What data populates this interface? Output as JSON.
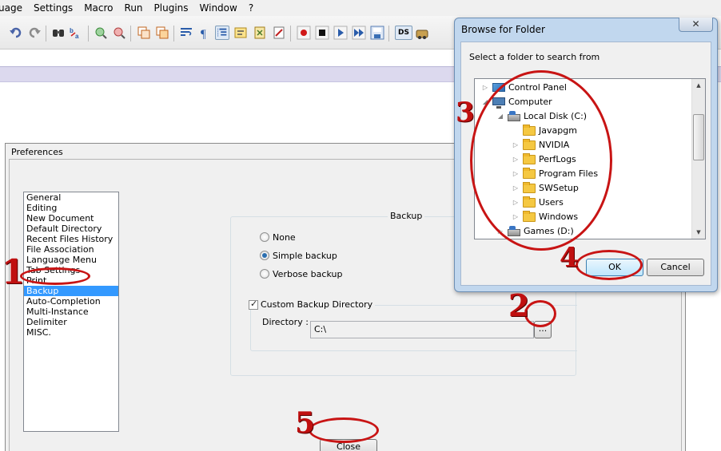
{
  "menubar": {
    "items": [
      "uage",
      "Settings",
      "Macro",
      "Run",
      "Plugins",
      "Window",
      "?"
    ]
  },
  "toolbar": {
    "buttons": [
      "undo-icon",
      "redo-icon",
      "find-icon",
      "replace-icon",
      "zoom-in-icon",
      "zoom-out-icon",
      "sync-vertical-icon",
      "sync-horizontal-icon",
      "word-wrap-icon",
      "show-all-characters-icon",
      "indent-guide-icon",
      "user-language-icon",
      "document-map-icon",
      "function-list-icon",
      "record-macro-icon",
      "stop-recording-icon",
      "play-macro-icon",
      "run-macro-multiple-icon",
      "save-macro-icon",
      "ds-icon",
      "plugin-icon"
    ],
    "ds_label": "DS"
  },
  "preferences": {
    "title": "Preferences",
    "categories": [
      "General",
      "Editing",
      "New Document",
      "Default Directory",
      "Recent Files History",
      "File Association",
      "Language Menu",
      "Tab Settings",
      "Print",
      "Backup",
      "Auto-Completion",
      "Multi-Instance",
      "Delimiter",
      "MISC."
    ],
    "selected_category": "Backup",
    "backup": {
      "legend": "Backup",
      "options": [
        "None",
        "Simple backup",
        "Verbose backup"
      ],
      "selected": "Simple backup"
    },
    "custom_dir": {
      "label": "Custom Backup Directory",
      "checked": true,
      "directory_label": "Directory :",
      "directory_value": "C:\\",
      "browse_label": "..."
    },
    "close_label": "Close"
  },
  "browse_dialog": {
    "title": "Browse for Folder",
    "close_glyph": "✕",
    "instruction": "Select a folder to search from",
    "tree": [
      {
        "label": "Control Panel",
        "icon": "control-panel-icon",
        "level": 0,
        "arrow": "▷"
      },
      {
        "label": "Computer",
        "icon": "computer-icon",
        "level": 0,
        "arrow": "◢"
      },
      {
        "label": "Local Disk (C:)",
        "icon": "local-disk-icon",
        "level": 1,
        "arrow": "◢"
      },
      {
        "label": "Javapgm",
        "icon": "folder-icon",
        "level": 2,
        "arrow": ""
      },
      {
        "label": "NVIDIA",
        "icon": "folder-icon",
        "level": 2,
        "arrow": "▷"
      },
      {
        "label": "PerfLogs",
        "icon": "folder-icon",
        "level": 2,
        "arrow": "▷"
      },
      {
        "label": "Program Files",
        "icon": "folder-icon",
        "level": 2,
        "arrow": "▷"
      },
      {
        "label": "SWSetup",
        "icon": "folder-icon",
        "level": 2,
        "arrow": "▷"
      },
      {
        "label": "Users",
        "icon": "folder-icon",
        "level": 2,
        "arrow": "▷"
      },
      {
        "label": "Windows",
        "icon": "folder-icon",
        "level": 2,
        "arrow": "▷"
      },
      {
        "label": "Games (D:)",
        "icon": "local-disk-icon",
        "level": 1,
        "arrow": "▷"
      }
    ],
    "ok_label": "OK",
    "cancel_label": "Cancel"
  },
  "annotations": {
    "color": "#c81414",
    "numbers": [
      "1",
      "2",
      "3",
      "4",
      "5"
    ]
  }
}
